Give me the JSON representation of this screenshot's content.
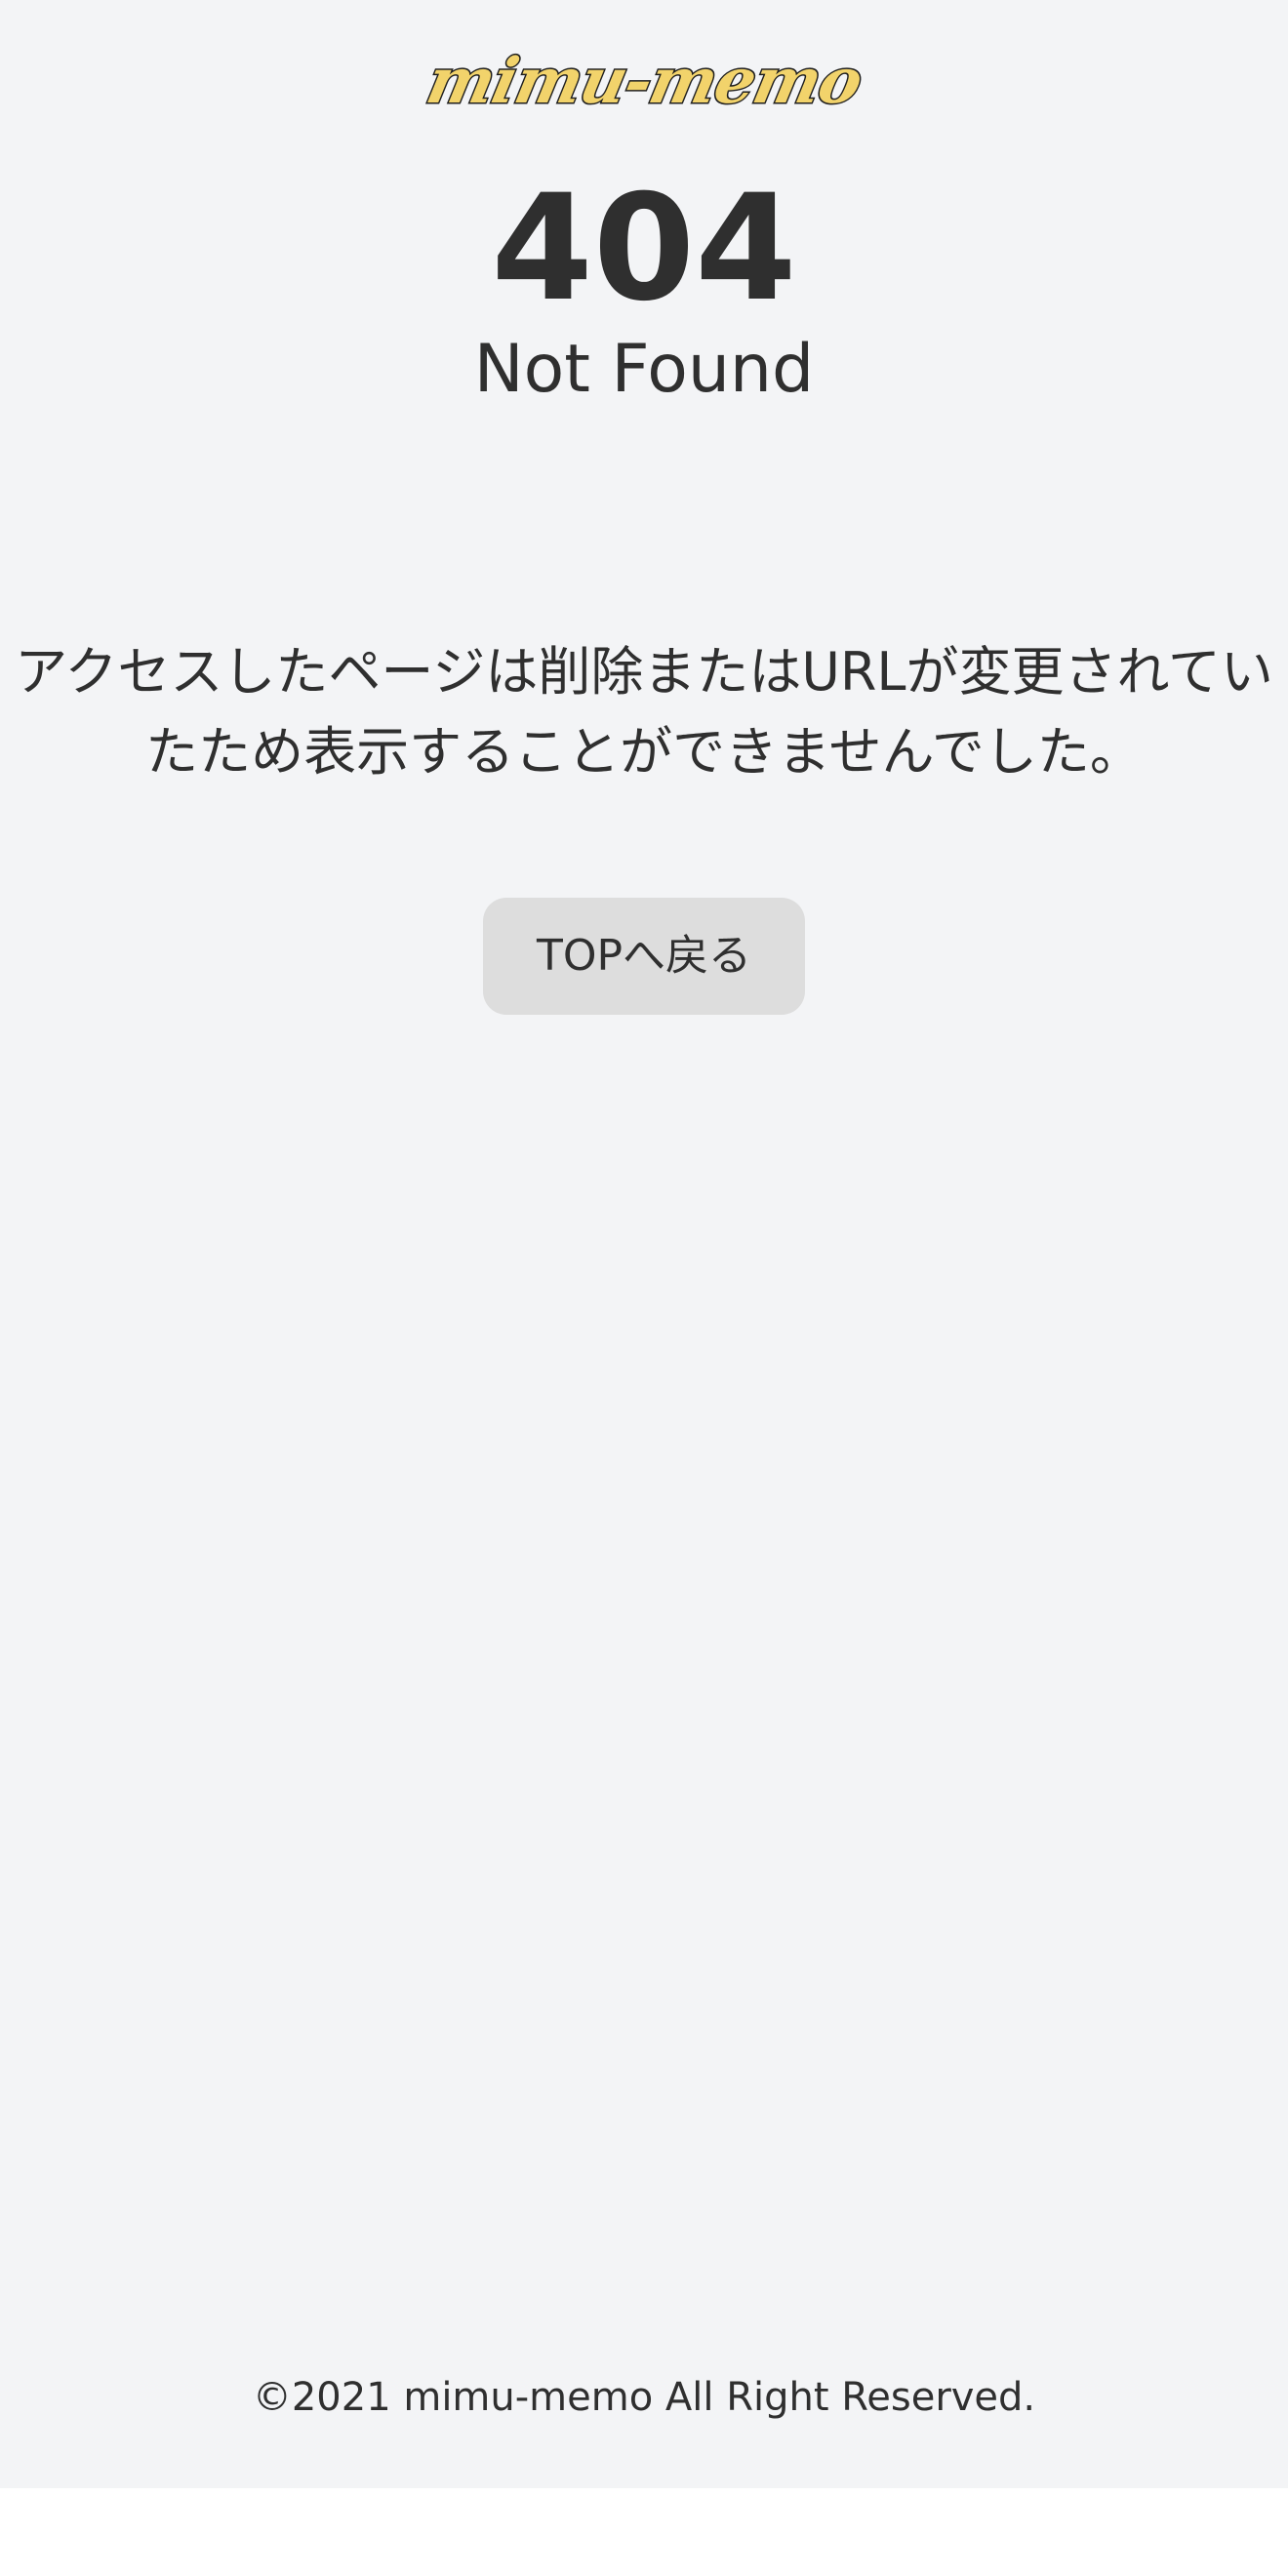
{
  "header": {
    "logo_text": "mimu-memo"
  },
  "error": {
    "code": "404",
    "title": "Not Found",
    "message_lines": [
      "アクセスしたページは削除またはURLが変更されてい",
      "たため表示することができませんでした。"
    ]
  },
  "actions": {
    "top_button_label": "TOPへ戻る"
  },
  "footer": {
    "copyright": "©2021 mimu-memo All Right Reserved."
  },
  "colors": {
    "page_background": "#f3f4f6",
    "text": "#2f2f2f",
    "button_background": "#dddddd",
    "logo_fill": "#f2d36b"
  }
}
